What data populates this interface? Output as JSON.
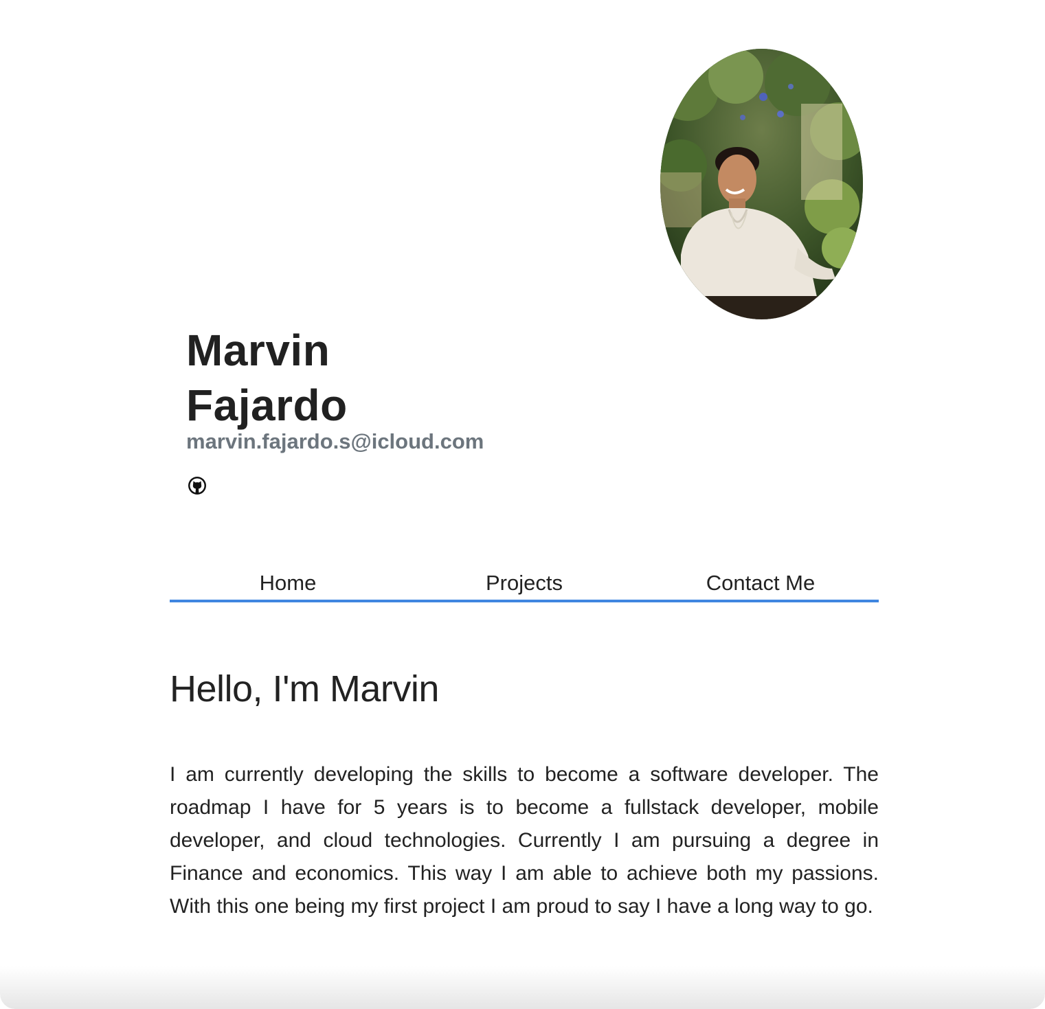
{
  "profile": {
    "first_name": "Marvin",
    "last_name": "Fajardo",
    "email": "marvin.fajardo.s@icloud.com",
    "photo_alt": "profile photo"
  },
  "social": {
    "github_icon": "github-icon"
  },
  "nav": {
    "items": [
      {
        "label": "Home"
      },
      {
        "label": "Projects"
      },
      {
        "label": "Contact Me"
      }
    ],
    "accent_color": "#3f86e0"
  },
  "main": {
    "greeting": "Hello, I'm Marvin",
    "bio": "I am currently developing the skills to become a software developer. The roadmap I have for 5 years is to become a fullstack developer, mobile developer, and cloud technologies. Currently I am pursuing a degree in Finance and economics. This way I am able to achieve both my passions. With this one being my first project I am proud to say I have a long way to go."
  },
  "colors": {
    "heading": "#212121",
    "email": "#6c757d",
    "text": "#222222"
  }
}
